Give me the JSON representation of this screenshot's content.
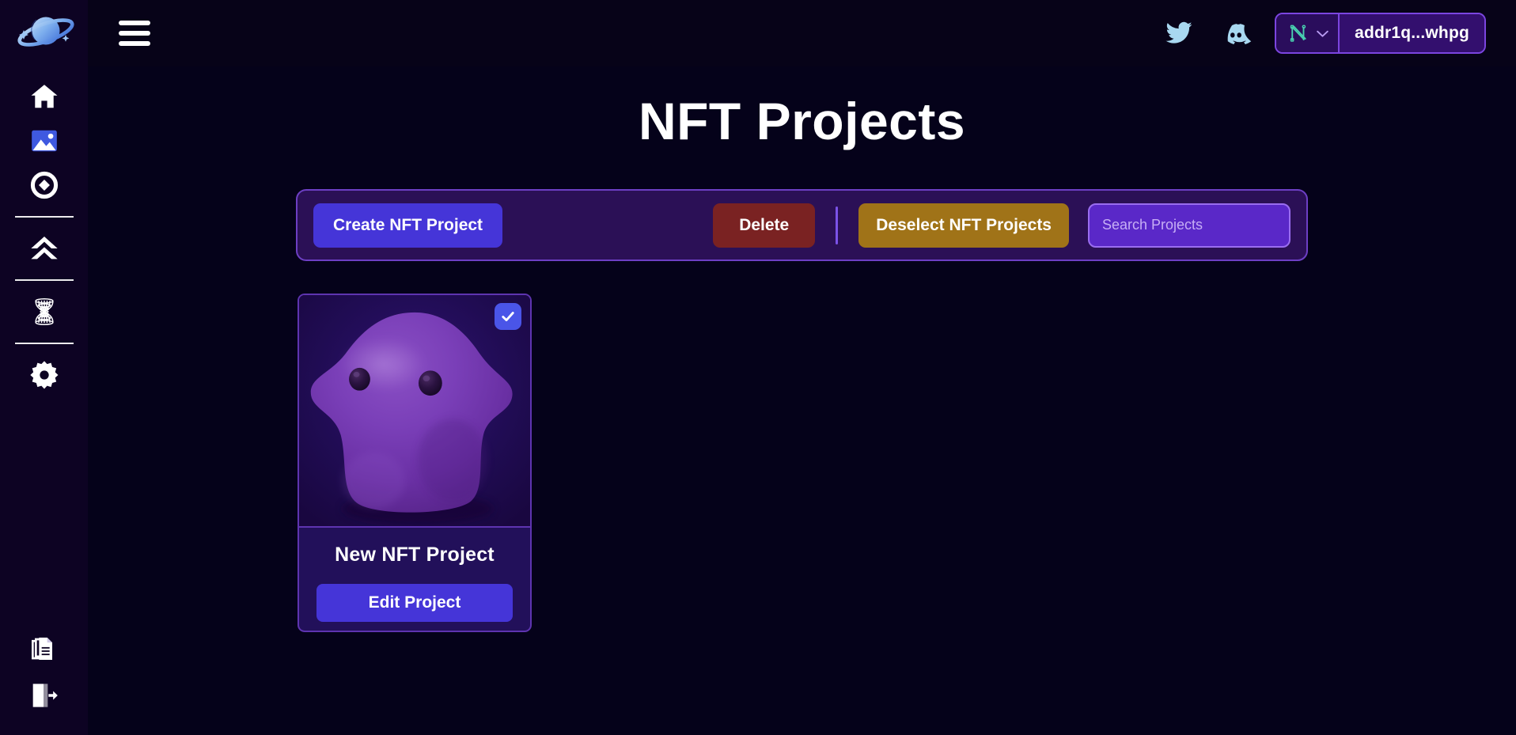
{
  "colors": {
    "page_bg": "#05021a",
    "sidebar_bg": "#0d0323",
    "topbar_bg": "#070318",
    "accent_indigo": "#4535d8",
    "accent_purple": "#5a28c8",
    "toolbar_bg": "#2b1056",
    "toolbar_border": "#6d3fc4",
    "delete_red": "#7a2222",
    "deselect_gold": "#a07318",
    "social_blue": "#a8d8f0",
    "nami_teal": "#49d0b0",
    "check_blue": "#4a55e8",
    "card_bg": "#22105a",
    "card_border": "#5e34b0"
  },
  "sidebar": {
    "logo": {
      "name": "planet-logo",
      "label": "Planet Logo"
    },
    "items": [
      {
        "id": "home",
        "icon": "home-icon",
        "label": "Home",
        "active": false
      },
      {
        "id": "gallery",
        "icon": "image-icon",
        "label": "Gallery",
        "active": true
      },
      {
        "id": "mint",
        "icon": "target-icon",
        "label": "Mint",
        "active": false
      }
    ],
    "items_group2": [
      {
        "id": "upgrade",
        "icon": "chevrons-up-icon",
        "label": "Upgrade",
        "active": false
      }
    ],
    "items_group3": [
      {
        "id": "mesh",
        "icon": "hyperboloid-icon",
        "label": "Mesh",
        "active": false
      }
    ],
    "items_group4": [
      {
        "id": "settings",
        "icon": "gear-icon",
        "label": "Settings",
        "active": false
      }
    ],
    "bottom_items": [
      {
        "id": "docs",
        "icon": "documents-icon",
        "label": "Documents"
      },
      {
        "id": "logout",
        "icon": "logout-icon",
        "label": "Log Out"
      }
    ]
  },
  "topbar": {
    "menu_icon": "hamburger-icon",
    "social": [
      {
        "id": "twitter",
        "icon": "twitter-icon",
        "label": "Twitter"
      },
      {
        "id": "discord",
        "icon": "discord-icon",
        "label": "Discord"
      }
    ],
    "wallet": {
      "icon": "nami-wallet-icon",
      "chevron": "chevron-down-icon",
      "address": "addr1q...whpg"
    }
  },
  "page": {
    "title": "NFT Projects"
  },
  "toolbar": {
    "create_label": "Create NFT Project",
    "delete_label": "Delete",
    "deselect_label": "Deselect NFT Projects",
    "search": {
      "value": "",
      "placeholder": "Search Projects",
      "icon": "search-icon"
    }
  },
  "projects": [
    {
      "title": "New NFT Project",
      "edit_label": "Edit Project",
      "selected": true,
      "thumbnail_alt": "purple-blob-nft-artwork"
    }
  ]
}
